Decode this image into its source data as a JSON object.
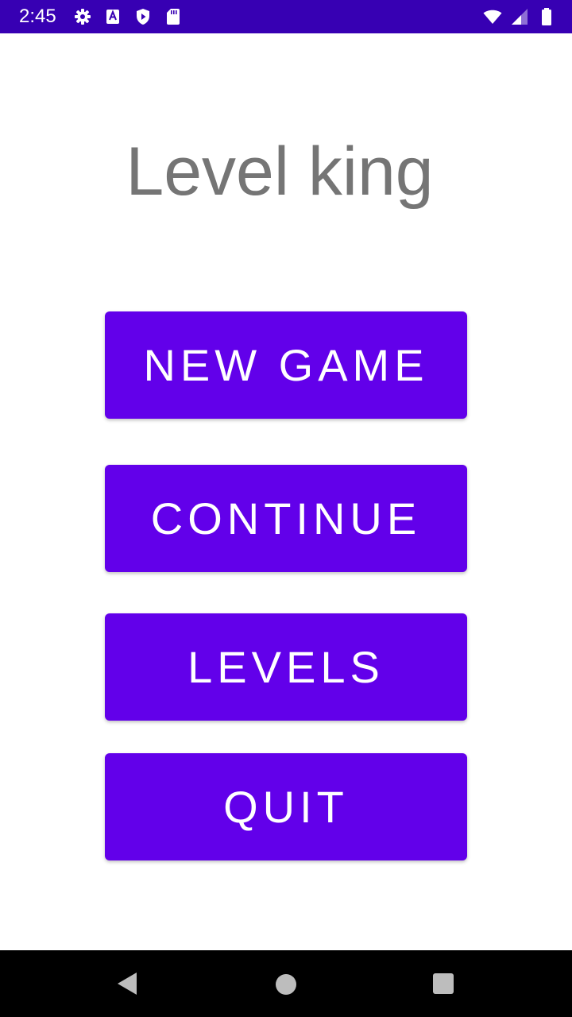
{
  "status_bar": {
    "time": "2:45",
    "left_icons": [
      "settings-icon",
      "a-notification-icon",
      "shield-play-icon",
      "sd-card-icon"
    ],
    "right_icons": [
      "wifi-icon",
      "cell-signal-icon",
      "battery-icon"
    ],
    "background": "#3700b3"
  },
  "main": {
    "title": "Level king",
    "buttons": {
      "new_game": "NEW GAME",
      "continue": "CONTINUE",
      "levels": "LEVELS",
      "quit": "QUIT"
    },
    "button_color": "#6200ea",
    "title_color": "#757575"
  },
  "nav_bar": {
    "icons": [
      "back-icon",
      "home-icon",
      "recents-icon"
    ]
  }
}
